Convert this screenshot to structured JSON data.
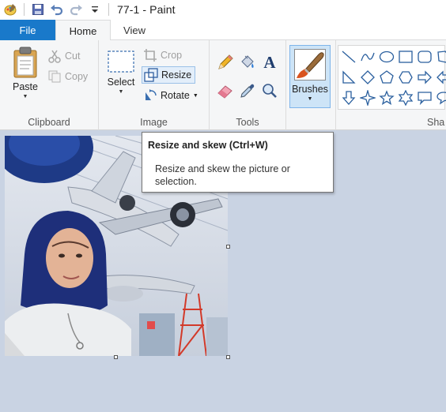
{
  "window": {
    "title": "77-1 - Paint"
  },
  "quick_access": {
    "items": [
      "paint-app-icon",
      "save-icon",
      "undo-icon",
      "redo-icon",
      "customize-dropdown-icon"
    ]
  },
  "tabs": [
    {
      "label": "File",
      "active": false,
      "color": "#1979ca"
    },
    {
      "label": "Home",
      "active": true
    },
    {
      "label": "View",
      "active": false
    }
  ],
  "ribbon": {
    "clipboard": {
      "label": "Clipboard",
      "paste": "Paste",
      "cut": "Cut",
      "copy": "Copy"
    },
    "image": {
      "label": "Image",
      "select": "Select",
      "crop": "Crop",
      "resize": "Resize",
      "rotate": "Rotate"
    },
    "tools": {
      "label": "Tools",
      "items": [
        "pencil-icon",
        "fill-bucket-icon",
        "text-icon",
        "eraser-icon",
        "color-picker-icon",
        "magnifier-icon"
      ]
    },
    "brushes": {
      "label": "Brushes"
    },
    "shapes": {
      "label": "Sha"
    }
  },
  "tooltip": {
    "title": "Resize and skew (Ctrl+W)",
    "body": "Resize and skew the picture or selection."
  },
  "colors": {
    "accent": "#1979ca",
    "canvas_bg": "#c9d3e3",
    "ribbon_bg": "#f5f6f7"
  }
}
